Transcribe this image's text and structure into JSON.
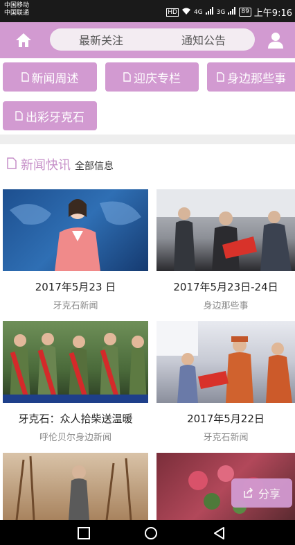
{
  "status_bar": {
    "carrier1": "中国移动",
    "carrier2": "中国联通",
    "hd": "HD",
    "net1": "4G",
    "net2": "3G",
    "battery": "89",
    "time": "上午9:16"
  },
  "header": {
    "tabs": [
      {
        "label": "最新关注"
      },
      {
        "label": "通知公告"
      }
    ]
  },
  "categories": [
    {
      "label": "新闻周述"
    },
    {
      "label": "迎庆专栏"
    },
    {
      "label": "身边那些事"
    },
    {
      "label": "出彩牙克石"
    }
  ],
  "section": {
    "title": "新闻快讯",
    "all": "全部信息"
  },
  "news": [
    {
      "title": "2017年5月23 日",
      "source": "牙克石新闻"
    },
    {
      "title": "2017年5月23日-24日",
      "source": "身边那些事"
    },
    {
      "title": "牙克石：众人拾柴送温暖",
      "source": "呼伦贝尔身边新闻"
    },
    {
      "title": "2017年5月22日",
      "source": "牙克石新闻"
    }
  ],
  "share": {
    "label": "分享"
  },
  "colors": {
    "accent": "#d29ad1",
    "title_accent": "#c68fc8"
  }
}
